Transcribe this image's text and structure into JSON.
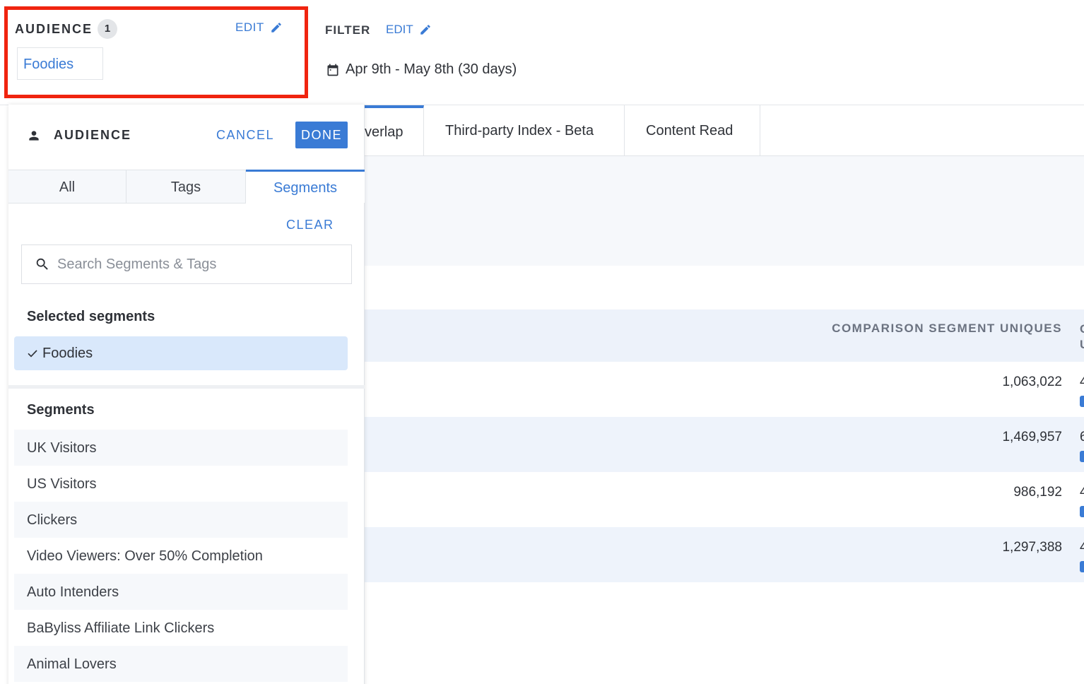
{
  "header": {
    "audience": {
      "title": "AUDIENCE",
      "count": "1",
      "edit_label": "EDIT",
      "chip": "Foodies"
    },
    "filter": {
      "title": "FILTER",
      "edit_label": "EDIT",
      "date_range": "Apr 9th - May 8th (30 days)"
    }
  },
  "tabs": [
    {
      "label": "verlap"
    },
    {
      "label": "Third-party Index - Beta"
    },
    {
      "label": "Content Read"
    }
  ],
  "table": {
    "column_header": "COMPARISON SEGMENT UNIQUES",
    "next_column_header_clipped": "C U",
    "rows": [
      {
        "value": "1,063,022",
        "next": "4"
      },
      {
        "value": "1,469,957",
        "next": "6"
      },
      {
        "value": "986,192",
        "next": "4"
      },
      {
        "value": "1,297,388",
        "next": "4"
      }
    ]
  },
  "panel": {
    "title": "AUDIENCE",
    "cancel_label": "CANCEL",
    "done_label": "DONE",
    "tabs": {
      "all": "All",
      "tags": "Tags",
      "segments": "Segments"
    },
    "clear_label": "CLEAR",
    "search_placeholder": "Search Segments & Tags",
    "selected_title": "Selected segments",
    "selected": [
      "Foodies"
    ],
    "segments_title": "Segments",
    "segments": [
      "UK Visitors",
      "US Visitors",
      "Clickers",
      "Video Viewers: Over 50% Completion",
      "Auto Intenders",
      "BaByliss Affiliate Link Clickers",
      "Animal Lovers"
    ]
  },
  "colors": {
    "accent": "#3a7bd5",
    "highlight_border": "#f0240f",
    "selected_bg": "#d9e8fb"
  },
  "icons": [
    "pencil-icon",
    "calendar-icon",
    "person-icon",
    "search-icon",
    "check-icon"
  ]
}
